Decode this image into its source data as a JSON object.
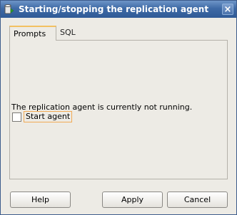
{
  "dialog": {
    "title": "Starting/stopping the replication agent",
    "close_symbol": "×",
    "icon": "database-icon"
  },
  "tabs": [
    {
      "label": "Prompts",
      "selected": true
    },
    {
      "label": "SQL",
      "selected": false
    }
  ],
  "prompts": {
    "status_message": "The replication agent is currently not running.",
    "start_agent": {
      "label": "Start agent",
      "checked": false
    }
  },
  "buttons": {
    "help": "Help",
    "apply": "Apply",
    "cancel": "Cancel"
  }
}
